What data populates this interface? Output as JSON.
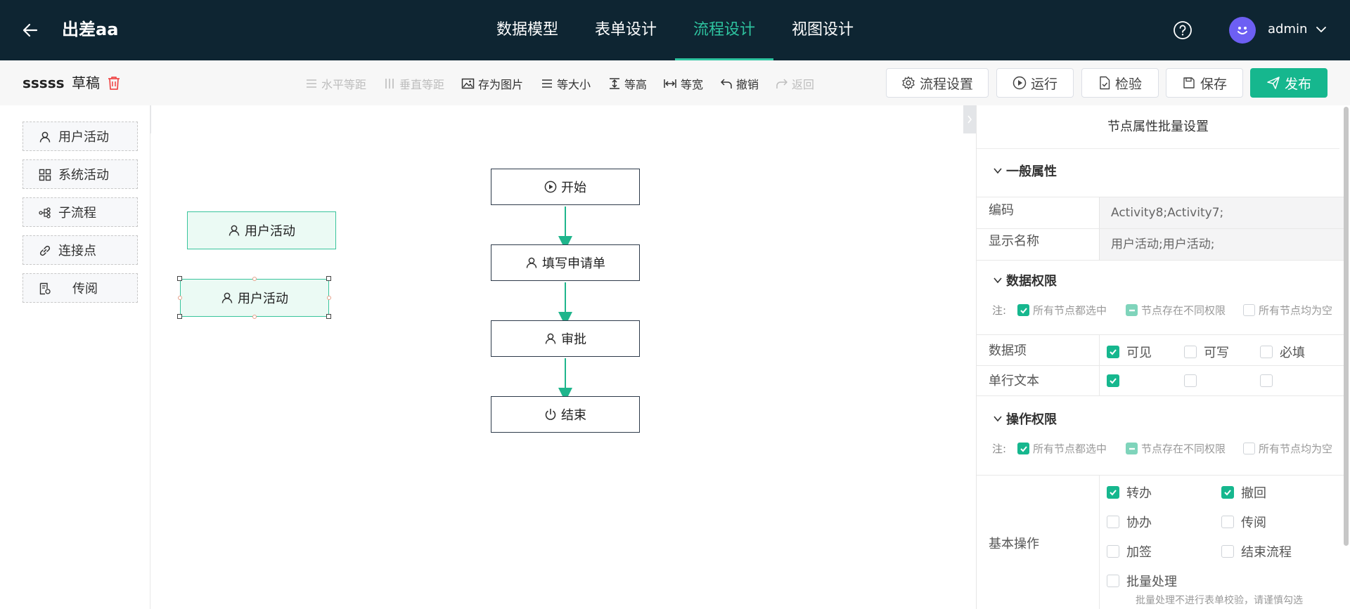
{
  "header": {
    "back_icon": "arrow-left-icon",
    "app_title": "出差aa",
    "tabs": [
      {
        "label": "数据模型",
        "active": false
      },
      {
        "label": "表单设计",
        "active": false
      },
      {
        "label": "流程设计",
        "active": true
      },
      {
        "label": "视图设计",
        "active": false
      }
    ],
    "help_icon": "question-circle-icon",
    "username": "admin",
    "accent_color": "#2ec4a0",
    "background_color": "#0e2532"
  },
  "toolbar": {
    "flow_name": "sssss",
    "flow_status": "草稿",
    "tools": [
      {
        "label": "水平等距",
        "icon": "horizontal-spacing-icon",
        "disabled": true
      },
      {
        "label": "垂直等距",
        "icon": "vertical-spacing-icon",
        "disabled": true
      },
      {
        "label": "存为图片",
        "icon": "image-icon",
        "disabled": false
      },
      {
        "label": "等大小",
        "icon": "same-size-icon",
        "disabled": false
      },
      {
        "label": "等高",
        "icon": "same-height-icon",
        "disabled": false
      },
      {
        "label": "等宽",
        "icon": "same-width-icon",
        "disabled": false
      },
      {
        "label": "撤销",
        "icon": "undo-icon",
        "disabled": false
      },
      {
        "label": "返回",
        "icon": "redo-icon",
        "disabled": true
      }
    ],
    "buttons": {
      "settings": "流程设置",
      "run": "运行",
      "check": "检验",
      "save": "保存",
      "publish": "发布"
    },
    "primary_color": "#16b78e"
  },
  "palette": {
    "items": [
      {
        "label": "用户活动",
        "icon": "user-icon"
      },
      {
        "label": "系统活动",
        "icon": "grid-icon"
      },
      {
        "label": "子流程",
        "icon": "subprocess-icon"
      },
      {
        "label": "连接点",
        "icon": "link-icon"
      },
      {
        "label": "传阅",
        "icon": "document-icon"
      }
    ]
  },
  "canvas": {
    "loose_nodes": [
      {
        "label": "用户活动",
        "selected": false
      },
      {
        "label": "用户活动",
        "selected": true
      }
    ],
    "flow_nodes": [
      {
        "label": "开始",
        "icon": "play-circle-icon"
      },
      {
        "label": "填写申请单",
        "icon": "user-icon"
      },
      {
        "label": "审批",
        "icon": "user-icon"
      },
      {
        "label": "结束",
        "icon": "power-icon"
      }
    ]
  },
  "panel": {
    "title": "节点属性批量设置",
    "general": {
      "heading": "一般属性",
      "code_label": "编码",
      "code_value": "Activity8;Activity7;",
      "name_label": "显示名称",
      "name_value": "用户活动;用户活动;"
    },
    "data_permission": {
      "heading": "数据权限",
      "note_label": "注:",
      "legend": [
        "所有节点都选中",
        "节点存在不同权限",
        "所有节点均为空"
      ],
      "column_label": "数据项",
      "columns": [
        "可见",
        "可写",
        "必填"
      ],
      "rows": [
        {
          "label": "单行文本",
          "visible": true,
          "writable": false,
          "required": false
        }
      ]
    },
    "operation_permission": {
      "heading": "操作权限",
      "note_label": "注:",
      "legend": [
        "所有节点都选中",
        "节点存在不同权限",
        "所有节点均为空"
      ],
      "basic_label": "基本操作",
      "ops": [
        {
          "label": "转办",
          "checked": true
        },
        {
          "label": "撤回",
          "checked": true
        },
        {
          "label": "协办",
          "checked": false
        },
        {
          "label": "传阅",
          "checked": false
        },
        {
          "label": "加签",
          "checked": false
        },
        {
          "label": "结束流程",
          "checked": false
        },
        {
          "label": "批量处理",
          "checked": false
        }
      ],
      "batch_hint": "批量处理不进行表单校验，请谨慎勾选"
    }
  }
}
